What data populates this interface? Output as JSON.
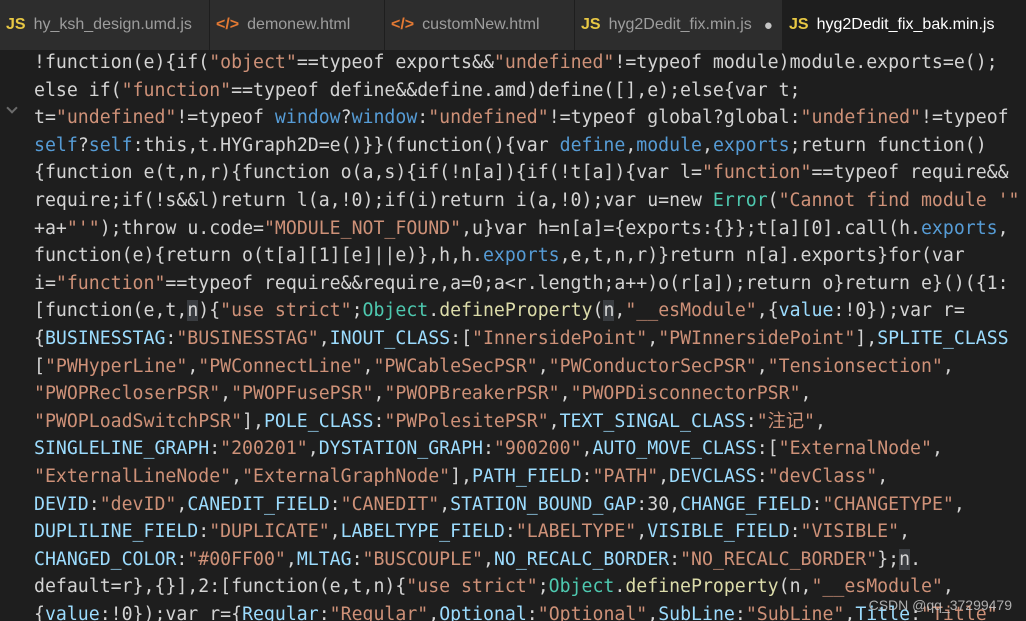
{
  "tabs": [
    {
      "icon": "JS",
      "icon_type": "js",
      "label": "hy_ksh_design.umd.js",
      "active": false,
      "dirty": false
    },
    {
      "icon": "</>",
      "icon_type": "html",
      "label": "demonew.html",
      "active": false,
      "dirty": false
    },
    {
      "icon": "</>",
      "icon_type": "html",
      "label": "customNew.html",
      "active": false,
      "dirty": false
    },
    {
      "icon": "JS",
      "icon_type": "js",
      "label": "hyg2Dedit_fix.min.js",
      "active": false,
      "dirty": true
    },
    {
      "icon": "JS",
      "icon_type": "js",
      "label": "hyg2Dedit_fix_bak.min.js",
      "active": true,
      "dirty": false
    }
  ],
  "dirty_marker": "●",
  "colors": {
    "string": "#ce9178",
    "property": "#9cdcfe",
    "class": "#4ec9b0",
    "function": "#dcdcaa",
    "keyword": "#569cd6",
    "plain": "#d4d4d4",
    "background": "#1e1e1e",
    "js_icon": "#e8c844",
    "html_icon": "#e37933"
  },
  "code_lines": [
    [
      [
        "p",
        "!function(e){if("
      ],
      [
        "s",
        "\"object\""
      ],
      [
        "p",
        "==typeof exports&&"
      ],
      [
        "s",
        "\"undefined\""
      ],
      [
        "p",
        "!=typeof module)module.exports=e();"
      ]
    ],
    [
      [
        "p",
        "else if("
      ],
      [
        "s",
        "\"function\""
      ],
      [
        "p",
        "==typeof define&&define.amd)define([],e);else{var t;"
      ]
    ],
    [
      [
        "p",
        "t="
      ],
      [
        "s",
        "\"undefined\""
      ],
      [
        "p",
        "!=typeof "
      ],
      [
        "k",
        "window"
      ],
      [
        "p",
        "?"
      ],
      [
        "k",
        "window"
      ],
      [
        "p",
        ":"
      ],
      [
        "s",
        "\"undefined\""
      ],
      [
        "p",
        "!=typeof global?global:"
      ],
      [
        "s",
        "\"undefined\""
      ],
      [
        "p",
        "!=typeof"
      ]
    ],
    [
      [
        "k",
        "self"
      ],
      [
        "p",
        "?"
      ],
      [
        "k",
        "self"
      ],
      [
        "p",
        ":this,t.HYGraph2D=e()}}(function(){var "
      ],
      [
        "k",
        "define"
      ],
      [
        "p",
        ","
      ],
      [
        "k",
        "module"
      ],
      [
        "p",
        ","
      ],
      [
        "k",
        "exports"
      ],
      [
        "p",
        ";return function()"
      ]
    ],
    [
      [
        "p",
        "{function e(t,n,r){function o(a,s){if(!n[a]){if(!t[a]){var l="
      ],
      [
        "s",
        "\"function\""
      ],
      [
        "p",
        "==typeof require&&"
      ]
    ],
    [
      [
        "p",
        "require;if(!s&&l)return l(a,!0);if(i)return i(a,!0);var u=new "
      ],
      [
        "c",
        "Error"
      ],
      [
        "p",
        "("
      ],
      [
        "s",
        "\"Cannot find module '\""
      ]
    ],
    [
      [
        "p",
        "+a+"
      ],
      [
        "s",
        "\"'\""
      ],
      [
        "p",
        ");throw u.code="
      ],
      [
        "s",
        "\"MODULE_NOT_FOUND\""
      ],
      [
        "p",
        ",u}var h=n[a]={exports:{}};t[a][0].call(h."
      ],
      [
        "k",
        "exports"
      ],
      [
        "p",
        ","
      ]
    ],
    [
      [
        "p",
        "function(e){return o(t[a][1][e]||e)},h,h."
      ],
      [
        "k",
        "exports"
      ],
      [
        "p",
        ",e,t,n,r)}return n[a].exports}for(var"
      ]
    ],
    [
      [
        "p",
        "i="
      ],
      [
        "s",
        "\"function\""
      ],
      [
        "p",
        "==typeof require&&require,a=0;a<r.length;a++)o(r[a]);return o}return e}()({1:"
      ]
    ],
    [
      [
        "p",
        "[function(e,t,"
      ],
      [
        "h",
        "n"
      ],
      [
        "p",
        "){"
      ],
      [
        "s",
        "\"use strict\""
      ],
      [
        "p",
        ";"
      ],
      [
        "c",
        "Object"
      ],
      [
        "p",
        "."
      ],
      [
        "f",
        "defineProperty"
      ],
      [
        "p",
        "("
      ],
      [
        "h",
        "n"
      ],
      [
        "p",
        ","
      ],
      [
        "s",
        "\"__esModule\""
      ],
      [
        "p",
        ",{"
      ],
      [
        "v",
        "value"
      ],
      [
        "p",
        ":!0});var r="
      ]
    ],
    [
      [
        "p",
        "{"
      ],
      [
        "v",
        "BUSINESSTAG"
      ],
      [
        "p",
        ":"
      ],
      [
        "s",
        "\"BUSINESSTAG\""
      ],
      [
        "p",
        ","
      ],
      [
        "v",
        "INOUT_CLASS"
      ],
      [
        "p",
        ":["
      ],
      [
        "s",
        "\"InnersidePoint\""
      ],
      [
        "p",
        ","
      ],
      [
        "s",
        "\"PWInnersidePoint\""
      ],
      [
        "p",
        "],"
      ],
      [
        "v",
        "SPLITE_CLASS"
      ]
    ],
    [
      [
        "p",
        "["
      ],
      [
        "s",
        "\"PWHyperLine\""
      ],
      [
        "p",
        ","
      ],
      [
        "s",
        "\"PWConnectLine\""
      ],
      [
        "p",
        ","
      ],
      [
        "s",
        "\"PWCableSecPSR\""
      ],
      [
        "p",
        ","
      ],
      [
        "s",
        "\"PWConductorSecPSR\""
      ],
      [
        "p",
        ","
      ],
      [
        "s",
        "\"Tensionsection\""
      ],
      [
        "p",
        ","
      ]
    ],
    [
      [
        "s",
        "\"PWOPRecloserPSR\""
      ],
      [
        "p",
        ","
      ],
      [
        "s",
        "\"PWOPFusePSR\""
      ],
      [
        "p",
        ","
      ],
      [
        "s",
        "\"PWOPBreakerPSR\""
      ],
      [
        "p",
        ","
      ],
      [
        "s",
        "\"PWOPDisconnectorPSR\""
      ],
      [
        "p",
        ","
      ]
    ],
    [
      [
        "s",
        "\"PWOPLoadSwitchPSR\""
      ],
      [
        "p",
        "],"
      ],
      [
        "v",
        "POLE_CLASS"
      ],
      [
        "p",
        ":"
      ],
      [
        "s",
        "\"PWPolesitePSR\""
      ],
      [
        "p",
        ","
      ],
      [
        "v",
        "TEXT_SINGAL_CLASS"
      ],
      [
        "p",
        ":"
      ],
      [
        "s",
        "\"注记\""
      ],
      [
        "p",
        ","
      ]
    ],
    [
      [
        "v",
        "SINGLELINE_GRAPH"
      ],
      [
        "p",
        ":"
      ],
      [
        "s",
        "\"200201\""
      ],
      [
        "p",
        ","
      ],
      [
        "v",
        "DYSTATION_GRAPH"
      ],
      [
        "p",
        ":"
      ],
      [
        "s",
        "\"900200\""
      ],
      [
        "p",
        ","
      ],
      [
        "v",
        "AUTO_MOVE_CLASS"
      ],
      [
        "p",
        ":["
      ],
      [
        "s",
        "\"ExternalNode\""
      ],
      [
        "p",
        ","
      ]
    ],
    [
      [
        "s",
        "\"ExternalLineNode\""
      ],
      [
        "p",
        ","
      ],
      [
        "s",
        "\"ExternalGraphNode\""
      ],
      [
        "p",
        "],"
      ],
      [
        "v",
        "PATH_FIELD"
      ],
      [
        "p",
        ":"
      ],
      [
        "s",
        "\"PATH\""
      ],
      [
        "p",
        ","
      ],
      [
        "v",
        "DEVCLASS"
      ],
      [
        "p",
        ":"
      ],
      [
        "s",
        "\"devClass\""
      ],
      [
        "p",
        ","
      ]
    ],
    [
      [
        "v",
        "DEVID"
      ],
      [
        "p",
        ":"
      ],
      [
        "s",
        "\"devID\""
      ],
      [
        "p",
        ","
      ],
      [
        "v",
        "CANEDIT_FIELD"
      ],
      [
        "p",
        ":"
      ],
      [
        "s",
        "\"CANEDIT\""
      ],
      [
        "p",
        ","
      ],
      [
        "v",
        "STATION_BOUND_GAP"
      ],
      [
        "p",
        ":30,"
      ],
      [
        "v",
        "CHANGE_FIELD"
      ],
      [
        "p",
        ":"
      ],
      [
        "s",
        "\"CHANGETYPE\""
      ],
      [
        "p",
        ","
      ]
    ],
    [
      [
        "v",
        "DUPLILINE_FIELD"
      ],
      [
        "p",
        ":"
      ],
      [
        "s",
        "\"DUPLICATE\""
      ],
      [
        "p",
        ","
      ],
      [
        "v",
        "LABELTYPE_FIELD"
      ],
      [
        "p",
        ":"
      ],
      [
        "s",
        "\"LABELTYPE\""
      ],
      [
        "p",
        ","
      ],
      [
        "v",
        "VISIBLE_FIELD"
      ],
      [
        "p",
        ":"
      ],
      [
        "s",
        "\"VISIBLE\""
      ],
      [
        "p",
        ","
      ]
    ],
    [
      [
        "v",
        "CHANGED_COLOR"
      ],
      [
        "p",
        ":"
      ],
      [
        "s",
        "\"#00FF00\""
      ],
      [
        "p",
        ","
      ],
      [
        "v",
        "MLTAG"
      ],
      [
        "p",
        ":"
      ],
      [
        "s",
        "\"BUSCOUPLE\""
      ],
      [
        "p",
        ","
      ],
      [
        "v",
        "NO_RECALC_BORDER"
      ],
      [
        "p",
        ":"
      ],
      [
        "s",
        "\"NO_RECALC_BORDER\""
      ],
      [
        "p",
        "};"
      ],
      [
        "h",
        "n"
      ],
      [
        "p",
        "."
      ]
    ],
    [
      [
        "p",
        "default=r},{}],2:[function(e,t,n){"
      ],
      [
        "s",
        "\"use strict\""
      ],
      [
        "p",
        ";"
      ],
      [
        "c",
        "Object"
      ],
      [
        "p",
        "."
      ],
      [
        "f",
        "defineProperty"
      ],
      [
        "p",
        "(n,"
      ],
      [
        "s",
        "\"__esModule\""
      ],
      [
        "p",
        ","
      ]
    ],
    [
      [
        "p",
        "{"
      ],
      [
        "v",
        "value"
      ],
      [
        "p",
        ":!0});var r={"
      ],
      [
        "v",
        "Regular"
      ],
      [
        "p",
        ":"
      ],
      [
        "s",
        "\"Regular\""
      ],
      [
        "p",
        ","
      ],
      [
        "v",
        "Optional"
      ],
      [
        "p",
        ":"
      ],
      [
        "s",
        "\"Optional\""
      ],
      [
        "p",
        ","
      ],
      [
        "v",
        "SubLine"
      ],
      [
        "p",
        ":"
      ],
      [
        "s",
        "\"SubLine\""
      ],
      [
        "p",
        ","
      ],
      [
        "v",
        "Title"
      ],
      [
        "p",
        ":"
      ],
      [
        "s",
        "\"Title\""
      ]
    ]
  ],
  "watermark": "CSDN @qq_37299479"
}
